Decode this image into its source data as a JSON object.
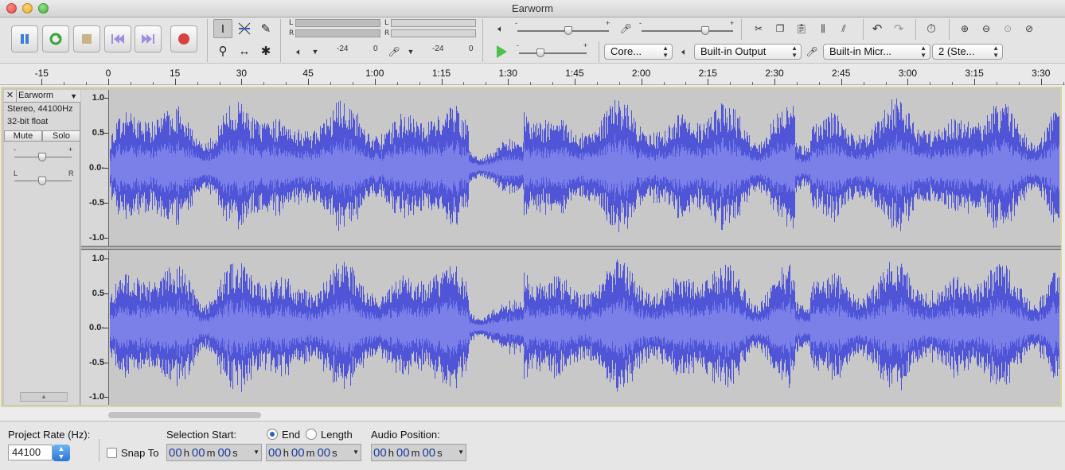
{
  "window": {
    "title": "Earworm"
  },
  "transport": {
    "buttons": [
      "pause-button",
      "loop-play-button",
      "stop-button",
      "skip-start-button",
      "skip-end-button",
      "record-button"
    ]
  },
  "meters": {
    "left_channel": "L",
    "right_channel": "R",
    "play_scale": [
      "-24",
      "0"
    ],
    "record_scale": [
      "-24",
      "0"
    ]
  },
  "mixer": {
    "minus": "-",
    "plus": "+"
  },
  "devices": {
    "host": "Core...",
    "output": "Built-in Output",
    "input": "Built-in Micr...",
    "channels": "2 (Ste..."
  },
  "ruler": {
    "labels": [
      "-15",
      "0",
      "15",
      "30",
      "45",
      "1:00",
      "1:15",
      "1:30",
      "1:45",
      "2:00",
      "2:15",
      "2:30",
      "2:45",
      "3:00",
      "3:15",
      "3:30"
    ]
  },
  "track": {
    "name": "Earworm",
    "format": "Stereo, 44100Hz",
    "bit_depth": "32-bit float",
    "mute_label": "Mute",
    "solo_label": "Solo",
    "gain_minus": "-",
    "gain_plus": "+",
    "pan_left": "L",
    "pan_right": "R",
    "collapse_icon": "up-arrow",
    "scale_labels": [
      "1.0",
      "0.5",
      "0.0-",
      "-0.5",
      "-1.0"
    ],
    "waveform_color": "#4f55d6",
    "waveform_rms_color": "#7a80e8"
  },
  "selection_bar": {
    "project_rate_label": "Project Rate (Hz):",
    "project_rate_value": "44100",
    "snap_to_label": "Snap To",
    "selection_start_label": "Selection Start:",
    "end_label": "End",
    "length_label": "Length",
    "audio_position_label": "Audio Position:",
    "time_digits": "00",
    "h": "h",
    "m": "m",
    "s": "s"
  }
}
